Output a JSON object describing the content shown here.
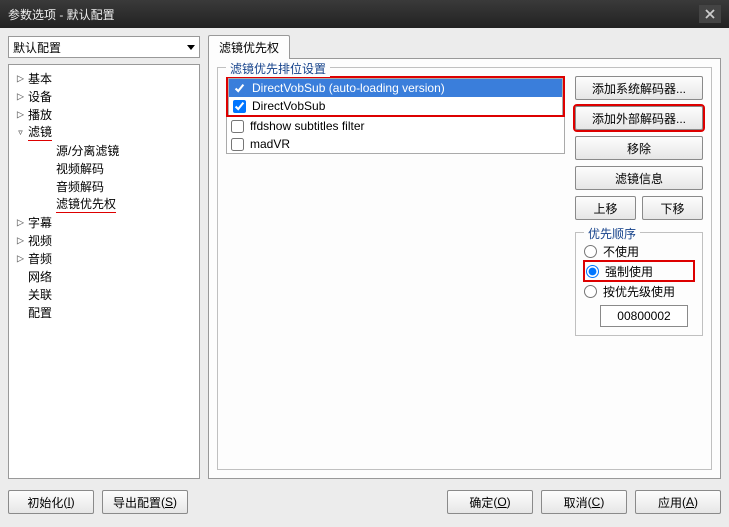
{
  "window": {
    "title": "参数选项 - 默认配置"
  },
  "combo": {
    "value": "默认配置"
  },
  "tree": [
    {
      "depth": 1,
      "twisty": "▷",
      "label": "基本"
    },
    {
      "depth": 1,
      "twisty": "▷",
      "label": "设备"
    },
    {
      "depth": 1,
      "twisty": "▷",
      "label": "播放"
    },
    {
      "depth": 1,
      "twisty": "▿",
      "label": "滤镜",
      "hl": true
    },
    {
      "depth": 2,
      "twisty": "",
      "label": "源/分离滤镜"
    },
    {
      "depth": 2,
      "twisty": "",
      "label": "视频解码"
    },
    {
      "depth": 2,
      "twisty": "",
      "label": "音频解码"
    },
    {
      "depth": 2,
      "twisty": "",
      "label": "滤镜优先权",
      "hl": true
    },
    {
      "depth": 1,
      "twisty": "▷",
      "label": "字幕"
    },
    {
      "depth": 1,
      "twisty": "▷",
      "label": "视频"
    },
    {
      "depth": 1,
      "twisty": "▷",
      "label": "音频"
    },
    {
      "depth": 1,
      "twisty": "",
      "label": "网络"
    },
    {
      "depth": 1,
      "twisty": "",
      "label": "关联"
    },
    {
      "depth": 1,
      "twisty": "",
      "label": "配置"
    }
  ],
  "tab": {
    "label": "滤镜优先权"
  },
  "fieldset": {
    "legend": "滤镜优先排位设置"
  },
  "filters_top": [
    {
      "checked": true,
      "label": "DirectVobSub (auto-loading version)",
      "sel": true
    },
    {
      "checked": true,
      "label": "DirectVobSub"
    }
  ],
  "filters_rest": [
    {
      "checked": false,
      "label": "ffdshow subtitles filter"
    },
    {
      "checked": false,
      "label": "madVR"
    }
  ],
  "buttons": {
    "add_sys": "添加系统解码器...",
    "add_ext": "添加外部解码器...",
    "remove": "移除",
    "info": "滤镜信息",
    "up": "上移",
    "down": "下移"
  },
  "priority": {
    "legend": "优先顺序",
    "opt_none": "不使用",
    "opt_force": "强制使用",
    "opt_byprio": "按优先级使用",
    "value": "00800002",
    "selected": "force"
  },
  "bottom": {
    "init": "初始化",
    "init_k": "I",
    "export": "导出配置",
    "export_k": "S",
    "ok": "确定",
    "ok_k": "O",
    "cancel": "取消",
    "cancel_k": "C",
    "apply": "应用",
    "apply_k": "A"
  }
}
